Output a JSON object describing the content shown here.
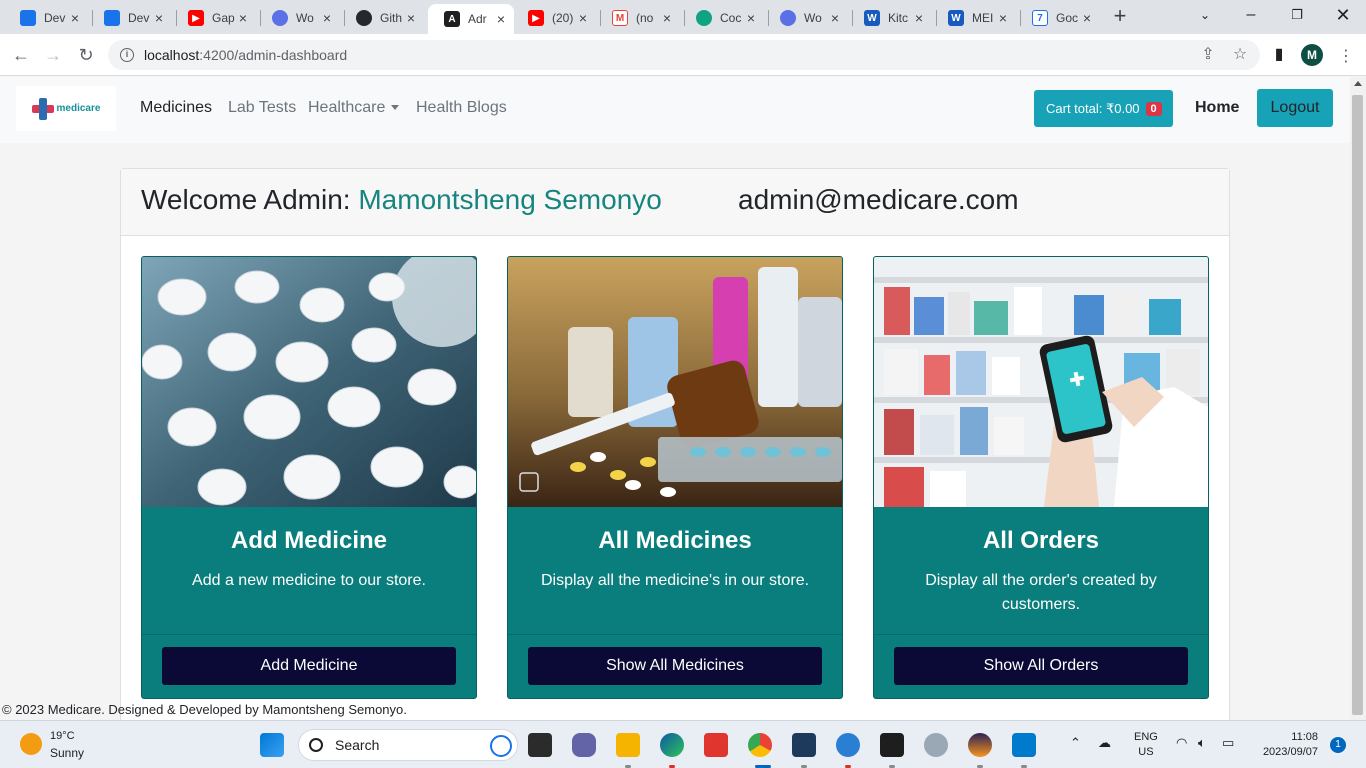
{
  "browser": {
    "tabs": [
      {
        "title": "Dev",
        "icon": "devops-icon",
        "color": "#1a73e8"
      },
      {
        "title": "Dev",
        "icon": "devops-icon",
        "color": "#1a73e8"
      },
      {
        "title": "Gap",
        "icon": "youtube-icon",
        "color": "#ff0000"
      },
      {
        "title": "Wo",
        "icon": "chrome-webstore-icon",
        "color": "#5b6fe6"
      },
      {
        "title": "Gith",
        "icon": "github-icon",
        "color": "#24292f"
      },
      {
        "title": "Adr",
        "icon": "angular-icon",
        "color": "#1f1f1f"
      },
      {
        "title": "(20)",
        "icon": "youtube-icon",
        "color": "#ff0000"
      },
      {
        "title": "(no",
        "icon": "gmail-icon",
        "color": "#ea4335"
      },
      {
        "title": "Coc",
        "icon": "chatgpt-icon",
        "color": "#10a37f"
      },
      {
        "title": "Wo",
        "icon": "chrome-webstore-icon",
        "color": "#5b6fe6"
      },
      {
        "title": "Kitc",
        "icon": "word-icon",
        "color": "#185abd"
      },
      {
        "title": "MEI",
        "icon": "word-icon",
        "color": "#185abd"
      },
      {
        "title": "Goc",
        "icon": "google-calendar-icon",
        "color": "#1a73e8"
      }
    ],
    "url_host": "localhost",
    "url_path": ":4200/admin-dashboard",
    "profile_initial": "M"
  },
  "navbar": {
    "brand": "medicare",
    "links": [
      "Medicines",
      "Lab Tests",
      "Healthcare",
      "Health Blogs"
    ],
    "cart_label": "Cart total: ₹0.00",
    "cart_count": "0",
    "home": "Home",
    "logout": "Logout"
  },
  "header": {
    "welcome_prefix": "Welcome Admin:",
    "admin_name": "Mamontsheng Semonyo",
    "admin_email": "admin@medicare.com"
  },
  "cards": [
    {
      "title": "Add Medicine",
      "description": "Add a new medicine to our store.",
      "button": "Add Medicine",
      "image": "pills-image"
    },
    {
      "title": "All Medicines",
      "description": "Display all the medicine's in our store.",
      "button": "Show All Medicines",
      "image": "medicine-bottles-image"
    },
    {
      "title": "All Orders",
      "description": "Display all the order's created by customers.",
      "button": "Show All Orders",
      "image": "pharmacy-phone-image"
    }
  ],
  "footer": "© 2023 Medicare. Designed & Developed by Mamontsheng Semonyo.",
  "taskbar": {
    "temperature": "19°C",
    "weather": "Sunny",
    "search_placeholder": "Search",
    "lang_top": "ENG",
    "lang_bottom": "US",
    "time": "11:08",
    "date": "2023/09/07",
    "notification_count": "1"
  },
  "colors": {
    "accent": "#17a2b8",
    "card_teal": "#0a7e7c",
    "card_button": "#0b0a36",
    "name_teal": "#17847f",
    "badge": "#dc3545"
  }
}
